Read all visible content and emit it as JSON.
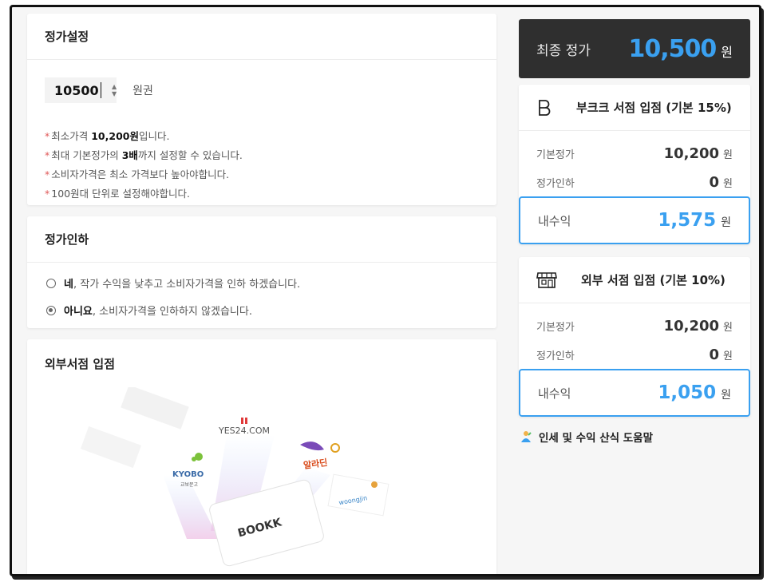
{
  "price_setting": {
    "title": "정가설정",
    "input_value": "10500",
    "unit_label": "원권",
    "notes": [
      {
        "pre": "최소가격 ",
        "bold": "10,200원",
        "post": "입니다."
      },
      {
        "pre": "최대 기본정가의 ",
        "bold": "3배",
        "post": "까지 설정할 수 있습니다."
      },
      {
        "pre": "소비자가격은 최소 가격보다 높아야합니다.",
        "bold": "",
        "post": ""
      },
      {
        "pre": "100원대 단위로 설정해야합니다.",
        "bold": "",
        "post": ""
      }
    ]
  },
  "discount": {
    "title": "정가인하",
    "options": [
      {
        "bold": "네",
        "text": ", 작가 수익을 낮추고 소비자가격을 인하 하겠습니다.",
        "checked": false
      },
      {
        "bold": "아니요",
        "text": ", 소비자가격을 인하하지 않겠습니다.",
        "checked": true
      }
    ]
  },
  "external_stores": {
    "title": "외부서점 입점",
    "logos": [
      "YES24.COM",
      "KYOBO",
      "교보문고",
      "알라딘",
      "woongjin",
      "BOOKK"
    ]
  },
  "final_price": {
    "label": "최종 정가",
    "value": "10,500",
    "unit": "원"
  },
  "bookk_store": {
    "title": "부크크 서점 입점 (기본 15%)",
    "base_label": "기본정가",
    "base_value": "10,200",
    "discount_label": "정가인하",
    "discount_value": "0",
    "income_label": "내수익",
    "income_value": "1,575",
    "unit": "원"
  },
  "ext_store": {
    "title": "외부 서점 입점 (기본 10%)",
    "base_label": "기본정가",
    "base_value": "10,200",
    "discount_label": "정가인하",
    "discount_value": "0",
    "income_label": "내수익",
    "income_value": "1,050",
    "unit": "원"
  },
  "help": {
    "label": "인세 및 수익 산식 도움말"
  },
  "colors": {
    "accent": "#3aa0f0",
    "dark_panel": "#2f2f2f",
    "note_star": "#e05a5a"
  }
}
